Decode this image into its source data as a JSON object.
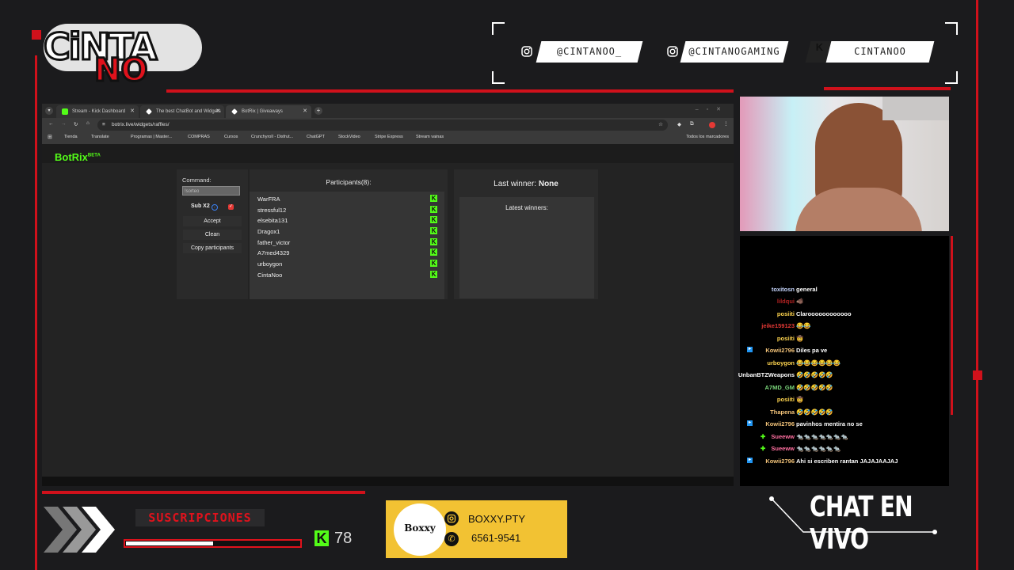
{
  "overlay": {
    "logo_line1": "CiNTA",
    "logo_line2": "NO",
    "socials": [
      {
        "icon": "instagram-icon",
        "label": "@CINTANOO_"
      },
      {
        "icon": "instagram-icon",
        "label": "@CINTANOGAMING"
      },
      {
        "icon": "kick-icon",
        "label": "CINTANOO"
      }
    ],
    "subs_label": "SUSCRIPCIONES",
    "subs_progress": 0.5,
    "kick_followers": "78",
    "sponsor": {
      "name": "BOXXY.PTY",
      "phone": "6561-9541",
      "logo_text": "Boxxy"
    },
    "chat_en_vivo": "CHAT EN VIVO",
    "accent_color": "#d0111b",
    "kick_green": "#53fc18"
  },
  "browser": {
    "tabs": [
      {
        "title": "Stream - Kick Dashboard",
        "icon": "kick-icon"
      },
      {
        "title": "The best ChatBot and Widgets",
        "icon": "botrix-icon"
      },
      {
        "title": "BotRix | Giveaways",
        "icon": "botrix-icon"
      }
    ],
    "new_tab": "+",
    "url": "botrix.live/widgets/raffles/",
    "bookmarks": [
      "Tienda",
      "Translate",
      "Programas | Master...",
      "COMPRAS",
      "Cursos",
      "Crunchyroll - Disfrut...",
      "ChatGPT",
      "StockVideo",
      "Stripe Express",
      "Stream vainas"
    ],
    "all_bookmarks": "Todos los marcadores"
  },
  "botrix": {
    "brand": "BotRix",
    "beta": "BETA",
    "command_label": "Command:",
    "command_value": "!sorteo",
    "sub_label": "Sub X2",
    "buttons": [
      "Accept",
      "Clean",
      "Copy participants"
    ],
    "participants_title": "Participants(8):",
    "participants": [
      "WarFRA",
      "stressful12",
      "elsebita131",
      "Dragox1",
      "father_victor",
      "A7med4329",
      "urboygon",
      "CintaNoo"
    ],
    "last_winner_label": "Last winner:",
    "last_winner_value": "None",
    "latest_winners_label": "Latest winners:"
  },
  "chat": [
    {
      "user": "toxitosn",
      "color": "#c7d7ff",
      "msg": "general"
    },
    {
      "user": "lildqui",
      "color": "#b22222",
      "msg": "🐗"
    },
    {
      "user": "posiiti",
      "color": "#ffd54f",
      "msg": "Claroooooooooooo"
    },
    {
      "user": "jeike159123",
      "color": "#e53935",
      "msg": "😂😂"
    },
    {
      "user": "posiiti",
      "color": "#ffd54f",
      "msg": "🤠"
    },
    {
      "user": "Kowii2796",
      "color": "#f5c57a",
      "msg": "Diles pa ve",
      "badge": true
    },
    {
      "user": "urboygon",
      "color": "#ffd54f",
      "msg": "😂😂😂😂😂😂"
    },
    {
      "user": "UnbanBTZWeapons",
      "color": "#ffffff",
      "msg": "🤣🤣🤣🤣🤣"
    },
    {
      "user": "A7MD_GM",
      "color": "#7cd97c",
      "msg": "🤣🤣🤣🤣🤣"
    },
    {
      "user": "posiiti",
      "color": "#ffd54f",
      "msg": "🤠"
    },
    {
      "user": "Thapena",
      "color": "#f5c57a",
      "msg": "🤣🤣🤣🤣🤣"
    },
    {
      "user": "Kowii2796",
      "color": "#f5c57a",
      "msg": "pavinhos mentira no se",
      "badge": true
    },
    {
      "user": "Sueeww",
      "color": "#ff6fa0",
      "msg": "🐀🐀🐀🐀🐀🐀🐀",
      "plus": true
    },
    {
      "user": "Sueeww",
      "color": "#ff6fa0",
      "msg": "🐀🐀🐀🐀🐀🐀",
      "plus": true
    },
    {
      "user": "Kowii2796",
      "color": "#f5c57a",
      "msg": "Ahi si escriben rantan JAJAJAAJAJ",
      "badge": true
    }
  ]
}
